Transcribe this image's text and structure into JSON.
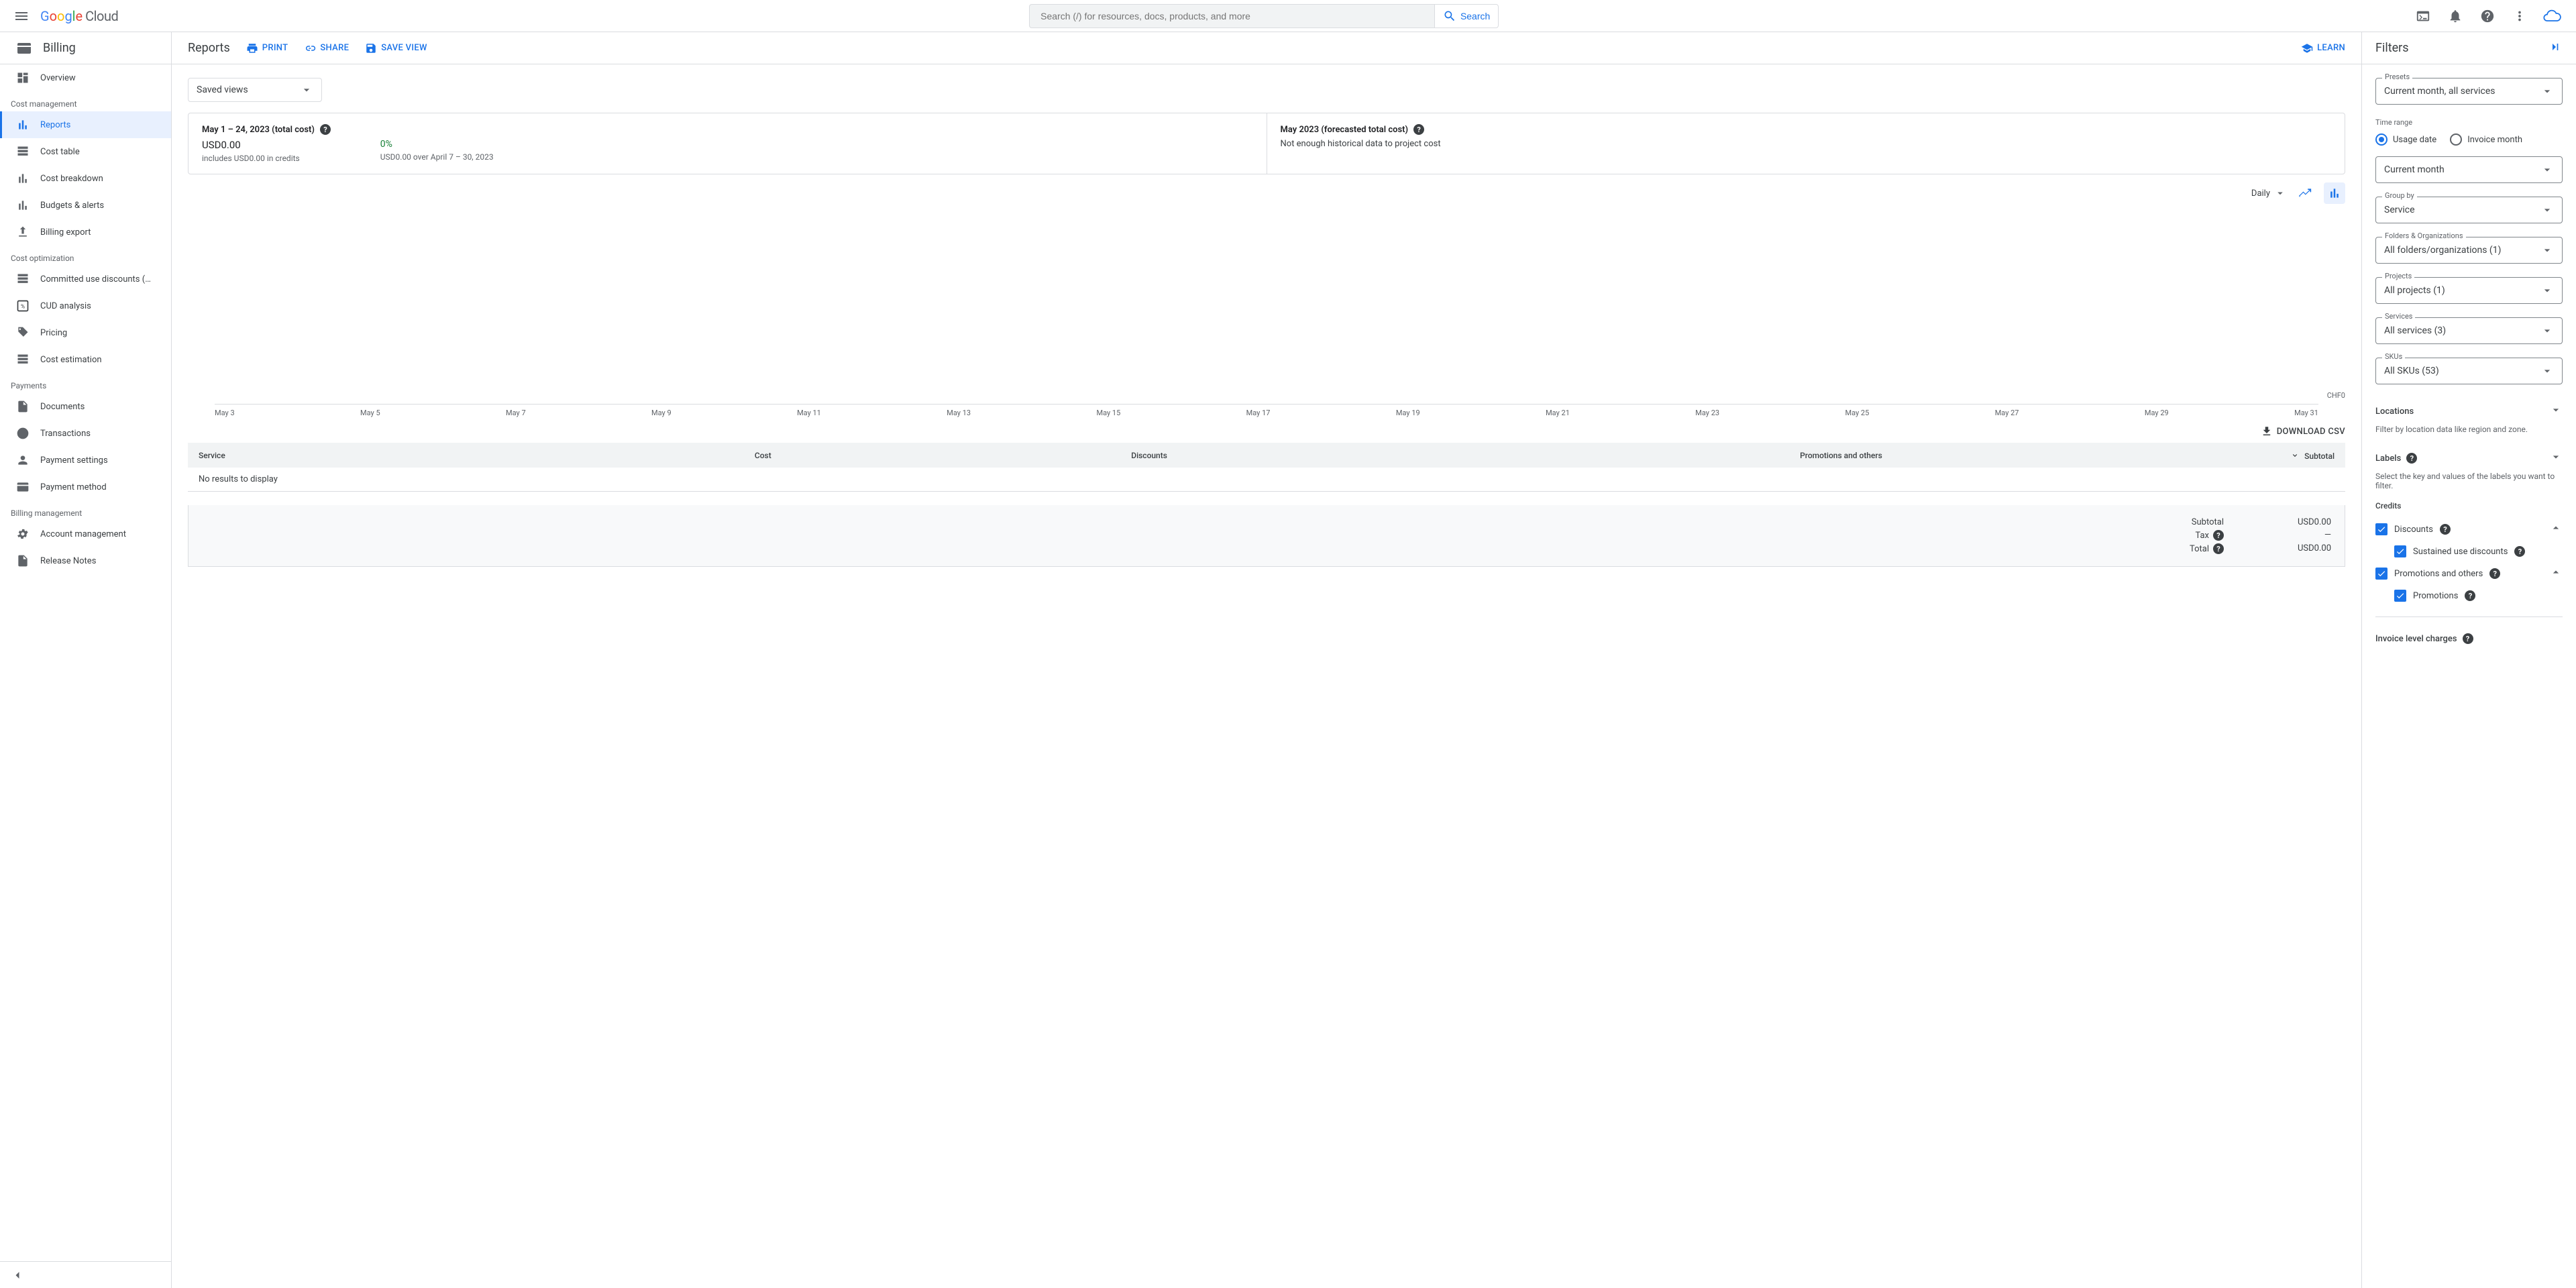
{
  "topbar": {
    "search_placeholder": "Search (/) for resources, docs, products, and more",
    "search_button": "Search"
  },
  "sidebar": {
    "title": "Billing",
    "groups": [
      {
        "label": null,
        "items": [
          {
            "label": "Overview",
            "icon": "dashboard"
          }
        ]
      },
      {
        "label": "Cost management",
        "items": [
          {
            "label": "Reports",
            "icon": "bar",
            "active": true
          },
          {
            "label": "Cost table",
            "icon": "table"
          },
          {
            "label": "Cost breakdown",
            "icon": "breakdown"
          },
          {
            "label": "Budgets & alerts",
            "icon": "bell-bar"
          },
          {
            "label": "Billing export",
            "icon": "export"
          }
        ]
      },
      {
        "label": "Cost optimization",
        "items": [
          {
            "label": "Committed use discounts (C...",
            "icon": "list"
          },
          {
            "label": "CUD analysis",
            "icon": "percent"
          },
          {
            "label": "Pricing",
            "icon": "tag"
          },
          {
            "label": "Cost estimation",
            "icon": "est"
          }
        ]
      },
      {
        "label": "Payments",
        "items": [
          {
            "label": "Documents",
            "icon": "doc"
          },
          {
            "label": "Transactions",
            "icon": "clock"
          },
          {
            "label": "Payment settings",
            "icon": "person"
          },
          {
            "label": "Payment method",
            "icon": "card"
          }
        ]
      },
      {
        "label": "Billing management",
        "items": [
          {
            "label": "Account management",
            "icon": "gear"
          },
          {
            "label": "Release Notes",
            "icon": "notes"
          }
        ]
      }
    ]
  },
  "main": {
    "title": "Reports",
    "actions": {
      "print": "PRINT",
      "share": "SHARE",
      "save_view": "SAVE VIEW",
      "learn": "LEARN"
    },
    "saved_views_label": "Saved views",
    "summary": {
      "card1": {
        "title": "May 1 – 24, 2023 (total cost)",
        "amount": "USD0.00",
        "credits_note": "includes USD0.00 in credits",
        "pct": "0%",
        "pct_note": "USD0.00 over April 7 – 30, 2023"
      },
      "card2": {
        "title": "May 2023 (forecasted total cost)",
        "note": "Not enough historical data to project cost"
      }
    },
    "chart": {
      "granularity": "Daily",
      "yzero": "CHF0"
    },
    "download_csv": "DOWNLOAD CSV",
    "table": {
      "cols": {
        "service": "Service",
        "cost": "Cost",
        "discounts": "Discounts",
        "promos": "Promotions and others",
        "subtotal": "Subtotal"
      },
      "no_results": "No results to display"
    },
    "totals": {
      "subtotal_label": "Subtotal",
      "subtotal_value": "USD0.00",
      "tax_label": "Tax",
      "tax_value": "—",
      "total_label": "Total",
      "total_value": "USD0.00"
    }
  },
  "filters": {
    "title": "Filters",
    "presets": {
      "label": "Presets",
      "value": "Current month, all services"
    },
    "time_range_section": "Time range",
    "time_radio": {
      "usage": "Usage date",
      "invoice": "Invoice month"
    },
    "time_value": "Current month",
    "group_by": {
      "label": "Group by",
      "value": "Service"
    },
    "folders": {
      "label": "Folders & Organizations",
      "value": "All folders/organizations (1)"
    },
    "projects": {
      "label": "Projects",
      "value": "All projects (1)"
    },
    "services": {
      "label": "Services",
      "value": "All services (3)"
    },
    "skus": {
      "label": "SKUs",
      "value": "All SKUs (53)"
    },
    "locations": {
      "title": "Locations",
      "sub": "Filter by location data like region and zone."
    },
    "labels": {
      "title": "Labels",
      "sub": "Select the key and values of the labels you want to filter."
    },
    "credits": {
      "title": "Credits",
      "discounts": "Discounts",
      "sustained": "Sustained use discounts",
      "promos": "Promotions and others",
      "promotions": "Promotions"
    },
    "invoice_level": "Invoice level charges"
  },
  "chart_data": {
    "type": "bar",
    "categories": [
      "May 3",
      "May 5",
      "May 7",
      "May 9",
      "May 11",
      "May 13",
      "May 15",
      "May 17",
      "May 19",
      "May 21",
      "May 23",
      "May 25",
      "May 27",
      "May 29",
      "May 31"
    ],
    "values": [
      0,
      0,
      0,
      0,
      0,
      0,
      0,
      0,
      0,
      0,
      0,
      0,
      0,
      0,
      0
    ],
    "title": "",
    "xlabel": "",
    "ylabel": "CHF",
    "ylim": [
      0,
      0
    ]
  }
}
